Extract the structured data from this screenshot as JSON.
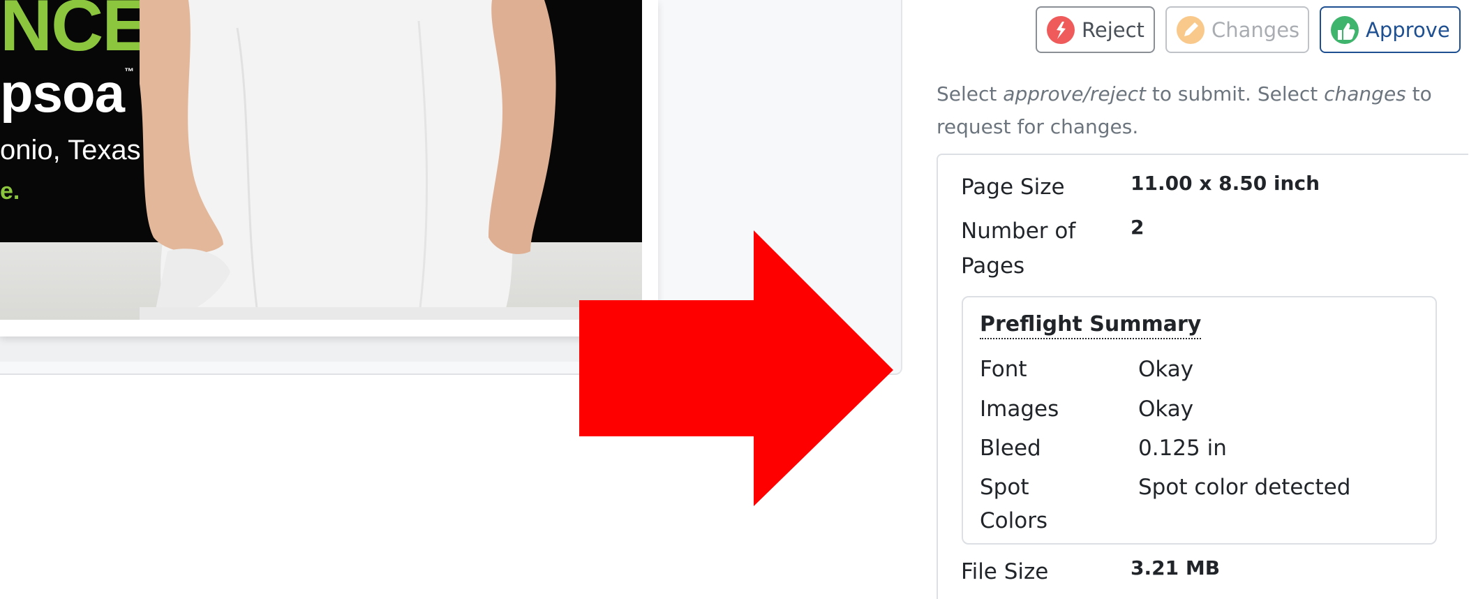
{
  "proof": {
    "headline": "NCE",
    "brand": "psoa",
    "brand_mark": "™",
    "location": "onio, Texas",
    "tagline": "e."
  },
  "actions": {
    "reject_label": "Reject",
    "changes_label": "Changes",
    "approve_label": "Approve"
  },
  "help": {
    "p1": "Select ",
    "em1": "approve/reject",
    "p2": " to submit. Select ",
    "em2": "changes",
    "p3": " to request for changes."
  },
  "details": {
    "page_size_label": "Page Size",
    "page_size_value": "11.00 x 8.50 inch",
    "num_pages_label": "Number of Pages",
    "num_pages_value": "2",
    "file_size_label": "File Size",
    "file_size_value": "3.21 MB"
  },
  "preflight": {
    "title": "Preflight Summary",
    "rows": [
      {
        "label": "Font",
        "value": "Okay"
      },
      {
        "label": "Images",
        "value": "Okay"
      },
      {
        "label": "Bleed",
        "value": "0.125 in"
      },
      {
        "label": "Spot Colors",
        "value": "Spot color detected"
      }
    ]
  },
  "colors": {
    "arrow": "#ff0000",
    "brand_green": "#8cc63f",
    "approve_blue": "#1d4f91"
  }
}
